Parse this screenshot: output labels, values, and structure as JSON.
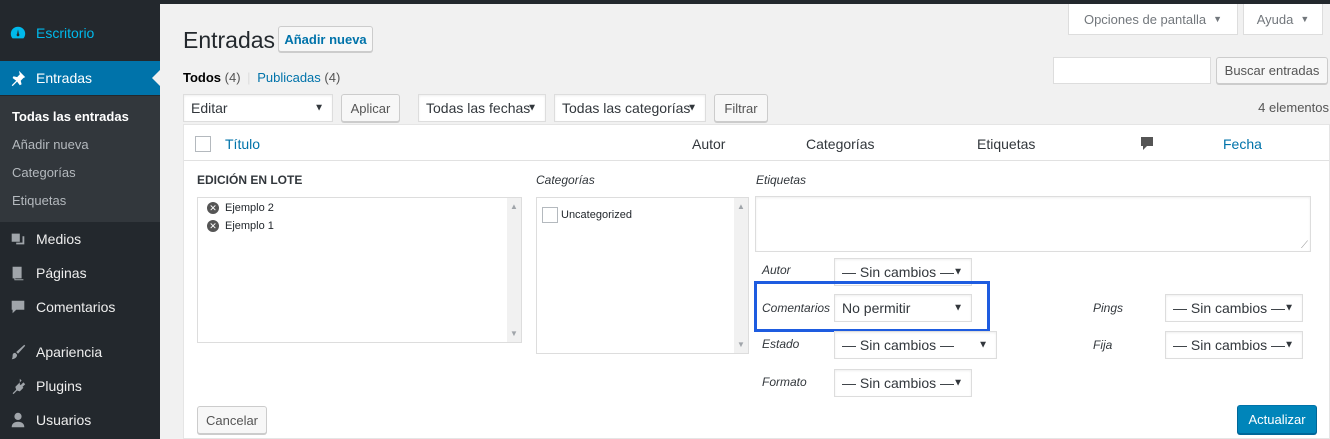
{
  "sidebar": {
    "dashboard": "Escritorio",
    "posts": "Entradas",
    "submenu": [
      "Todas las entradas",
      "Añadir nueva",
      "Categorías",
      "Etiquetas"
    ],
    "media": "Medios",
    "pages": "Páginas",
    "comments": "Comentarios",
    "appearance": "Apariencia",
    "plugins": "Plugins",
    "users": "Usuarios"
  },
  "header": {
    "title": "Entradas",
    "add_new": "Añadir nueva",
    "screen_options": "Opciones de pantalla",
    "help": "Ayuda"
  },
  "views": {
    "all_label": "Todos",
    "all_count": "(4)",
    "sep": "|",
    "published_label": "Publicadas",
    "published_count": "(4)"
  },
  "search": {
    "button": "Buscar entradas",
    "value": ""
  },
  "filters": {
    "bulk_action": "Editar",
    "apply": "Aplicar",
    "dates": "Todas las fechas",
    "categories": "Todas las categorías",
    "filter": "Filtrar",
    "item_count": "4 elementos"
  },
  "table": {
    "columns": {
      "title": "Título",
      "author": "Autor",
      "categories": "Categorías",
      "tags": "Etiquetas",
      "date": "Fecha"
    }
  },
  "bulk_edit": {
    "heading": "EDICIÓN EN LOTE",
    "posts": [
      "Ejemplo 2",
      "Ejemplo 1"
    ],
    "categories_label": "Categorías",
    "categories": [
      "Uncategorized"
    ],
    "tags_label": "Etiquetas",
    "author_label": "Autor",
    "author_value": "— Sin cambios —",
    "comments_label": "Comentarios",
    "comments_value": "No permitir",
    "status_label": "Estado",
    "status_value": "— Sin cambios —",
    "format_label": "Formato",
    "format_value": "— Sin cambios —",
    "pings_label": "Pings",
    "pings_value": "— Sin cambios —",
    "sticky_label": "Fija",
    "sticky_value": "— Sin cambios —",
    "cancel": "Cancelar",
    "update": "Actualizar"
  },
  "colors": {
    "accent": "#0073aa",
    "highlight": "#1e5ce0",
    "sidebar": "#23282d"
  }
}
